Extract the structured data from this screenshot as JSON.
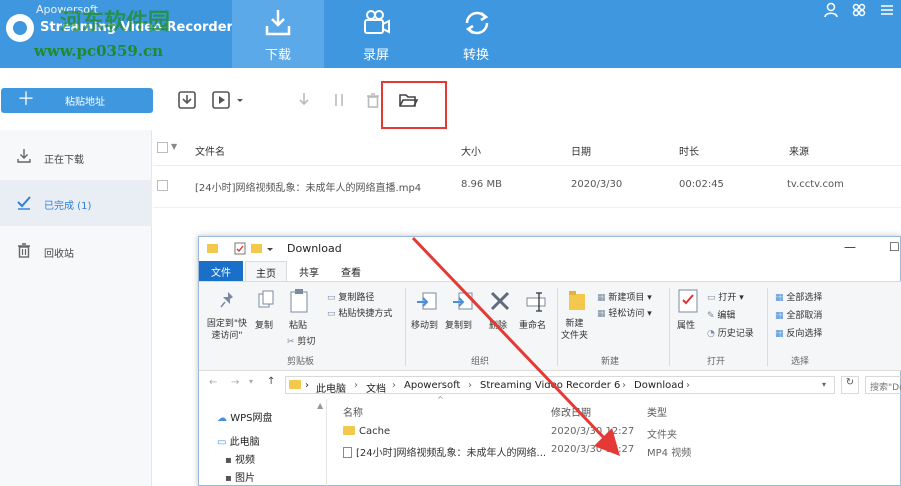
{
  "header": {
    "brand_small": "Apowersoft",
    "brand_big": "Streaming Video Recorder",
    "watermark_text": "www.pc0359.cn",
    "watermark_overlay": "河东软件园",
    "tabs": [
      {
        "label": "下载",
        "icon": "download-icon",
        "active": true
      },
      {
        "label": "录屏",
        "icon": "camera-icon",
        "active": false
      },
      {
        "label": "转换",
        "icon": "convert-icon",
        "active": false
      }
    ],
    "icons": [
      "user-icon",
      "skin-icon",
      "menu-icon"
    ],
    "accent": "#3f97e0"
  },
  "toolbar": {
    "paste_label": "粘贴地址",
    "icons": [
      "import-icon",
      "video-play-icon",
      "dropdown-icon",
      "start-download-icon",
      "pause-icon",
      "delete-icon",
      "open-folder-icon"
    ],
    "highlight_color": "#e53935"
  },
  "sidebar": {
    "items": [
      {
        "label": "正在下载",
        "icon": "download-icon",
        "active": false
      },
      {
        "label": "已完成 (1)",
        "icon": "checkmark-icon",
        "active": true
      },
      {
        "label": "回收站",
        "icon": "trash-icon",
        "active": false
      }
    ]
  },
  "list": {
    "columns": [
      "文件名",
      "大小",
      "日期",
      "时长",
      "来源"
    ],
    "rows": [
      {
        "name": "[24小时]网络视频乱象：未成年人的网络直播.mp4",
        "size": "8.96 MB",
        "date": "2020/3/30",
        "duration": "00:02:45",
        "source": "tv.cctv.com"
      }
    ]
  },
  "explorer": {
    "title": "Download",
    "tabs": [
      "文件",
      "主页",
      "共享",
      "查看"
    ],
    "ribbon": {
      "clipboard": {
        "pin": "固定到\"快\n速访问\"",
        "copy": "复制",
        "paste": "粘贴",
        "copy_path": "复制路径",
        "paste_shortcut": "粘贴快捷方式",
        "cut": "剪切",
        "group": "剪贴板"
      },
      "organize": {
        "move_to": "移动到",
        "copy_to": "复制到",
        "delete": "删除",
        "rename": "重命名",
        "group": "组织"
      },
      "new": {
        "new_folder": "新建\n文件夹",
        "new_item": "新建项目 ▾",
        "easy_access": "轻松访问 ▾",
        "group": "新建"
      },
      "open": {
        "properties": "属性",
        "open": "打开 ▾",
        "edit": "编辑",
        "history": "历史记录",
        "group": "打开"
      },
      "select": {
        "select_all": "全部选择",
        "select_none": "全部取消",
        "invert": "反向选择",
        "group": "选择"
      }
    },
    "path": [
      "此电脑",
      "文档",
      "Apowersoft",
      "Streaming Video Recorder 6",
      "Download"
    ],
    "search_placeholder": "搜索\"Do",
    "nav": [
      "WPS网盘",
      "此电脑",
      "视频",
      "图片"
    ],
    "file_columns": [
      "名称",
      "修改日期",
      "类型"
    ],
    "files": [
      {
        "name": "Cache",
        "date": "2020/3/30 12:27",
        "type": "文件夹"
      },
      {
        "name": "[24小时]网络视频乱象：未成年人的网络...",
        "date": "2020/3/30 12:27",
        "type": "MP4 视频"
      }
    ]
  }
}
